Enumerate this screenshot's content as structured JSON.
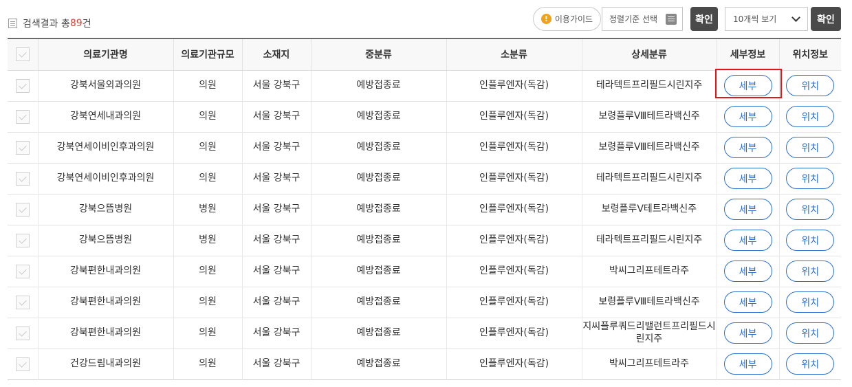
{
  "toolbar": {
    "result_prefix": "검색결과 총",
    "result_count": "89",
    "result_suffix": "건",
    "guide_label": "이용가이드",
    "sort_label": "정렬기준 선택",
    "confirm_label": "확인",
    "per_page_label": "10개씩 보기",
    "confirm2_label": "확인"
  },
  "table": {
    "headers": [
      "의료기관명",
      "의료기관규모",
      "소재지",
      "중분류",
      "소분류",
      "상세분류",
      "세부정보",
      "위치정보"
    ],
    "detail_button": "세부",
    "location_button": "위치",
    "rows": [
      {
        "name": "강북서울외과의원",
        "scale": "의원",
        "location": "서울 강북구",
        "mid": "예방접종료",
        "sub": "인플루엔자(독감)",
        "detail": "테라텍트프리필드시린지주"
      },
      {
        "name": "강북연세내과의원",
        "scale": "의원",
        "location": "서울 강북구",
        "mid": "예방접종료",
        "sub": "인플루엔자(독감)",
        "detail": "보령플루Ⅷ테트라백신주"
      },
      {
        "name": "강북연세이비인후과의원",
        "scale": "의원",
        "location": "서울 강북구",
        "mid": "예방접종료",
        "sub": "인플루엔자(독감)",
        "detail": "보령플루Ⅷ테트라백신주"
      },
      {
        "name": "강북연세이비인후과의원",
        "scale": "의원",
        "location": "서울 강북구",
        "mid": "예방접종료",
        "sub": "인플루엔자(독감)",
        "detail": "테라텍트프리필드시린지주"
      },
      {
        "name": "강북으뜸병원",
        "scale": "병원",
        "location": "서울 강북구",
        "mid": "예방접종료",
        "sub": "인플루엔자(독감)",
        "detail": "보령플루Ⅴ테트라백신주"
      },
      {
        "name": "강북으뜸병원",
        "scale": "병원",
        "location": "서울 강북구",
        "mid": "예방접종료",
        "sub": "인플루엔자(독감)",
        "detail": "테라텍트프리필드시린지주"
      },
      {
        "name": "강북편한내과의원",
        "scale": "의원",
        "location": "서울 강북구",
        "mid": "예방접종료",
        "sub": "인플루엔자(독감)",
        "detail": "박씨그리프테트라주"
      },
      {
        "name": "강북편한내과의원",
        "scale": "의원",
        "location": "서울 강북구",
        "mid": "예방접종료",
        "sub": "인플루엔자(독감)",
        "detail": "보령플루Ⅷ테트라백신주"
      },
      {
        "name": "강북편한내과의원",
        "scale": "의원",
        "location": "서울 강북구",
        "mid": "예방접종료",
        "sub": "인플루엔자(독감)",
        "detail": "지씨플루쿼드리밸런트프리필드시린지주"
      },
      {
        "name": "건강드림내과의원",
        "scale": "의원",
        "location": "서울 강북구",
        "mid": "예방접종료",
        "sub": "인플루엔자(독감)",
        "detail": "박씨그리프테트라주"
      }
    ]
  },
  "colors": {
    "accent": "#2a6fcf",
    "count": "#e0423a",
    "highlight": "#e01818",
    "confirm_bg": "#4a4a4a"
  }
}
